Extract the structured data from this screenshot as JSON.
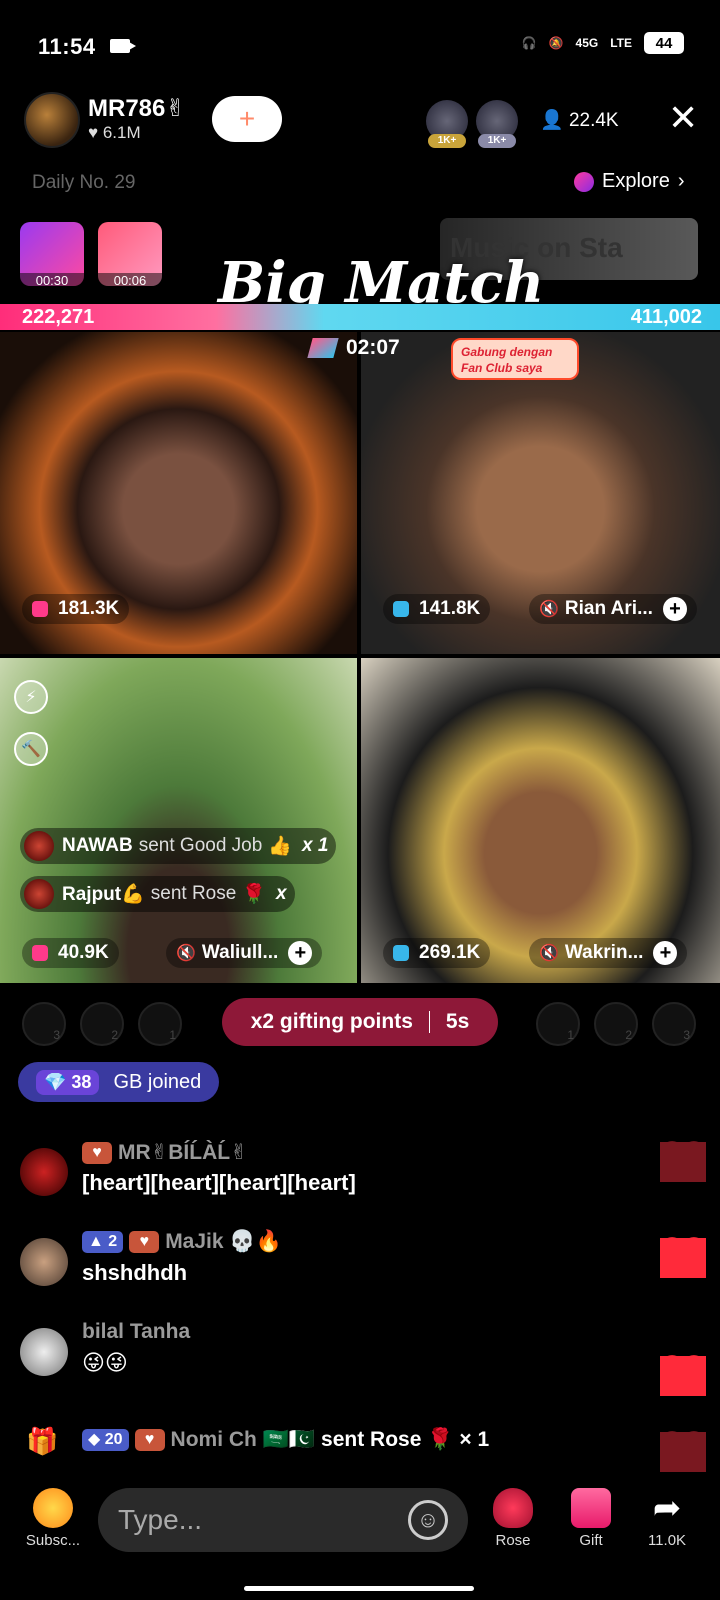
{
  "status_bar": {
    "time": "11:54",
    "network": "45G",
    "lte": "LTE",
    "battery": "44"
  },
  "header": {
    "host_name": "MR786✌",
    "host_likes": "♥ 6.1M",
    "follow_icon": "+",
    "top_viewer_badge_1": "1K+",
    "top_viewer_badge_2": "1K+",
    "viewer_count": "22.4K",
    "close_icon": "✕"
  },
  "subheader": {
    "daily_rank": "Daily No. 29",
    "explore_label": "Explore",
    "badge_1_timer": "00:30",
    "badge_2_timer": "00:06",
    "music_banner": "Music on Sta",
    "match_title": "Big Match"
  },
  "battle": {
    "score_left": "222,271",
    "score_right": "411,002",
    "timer": "02:07"
  },
  "videos": [
    {
      "score": "181.3K",
      "name": ""
    },
    {
      "score": "141.8K",
      "name": "Rian Ari...",
      "fanclub_text": "Gabung dengan Fan Club saya"
    },
    {
      "score": "40.9K",
      "name": "Waliull..."
    },
    {
      "score": "269.1K",
      "name": "Wakrin..."
    }
  ],
  "gift_notes": [
    {
      "name": "NAWAB",
      "action": "sent Good Job",
      "count": "x 1"
    },
    {
      "name": "Rajput💪",
      "action": "sent Rose",
      "count": "x"
    }
  ],
  "pk_bar": {
    "left_ranks": [
      "3",
      "2",
      "1"
    ],
    "right_ranks": [
      "1",
      "2",
      "3"
    ],
    "boost_label": "x2 gifting points",
    "boost_time": "5s"
  },
  "joined": {
    "level": "38",
    "text": "GB joined"
  },
  "chat": [
    {
      "user": "MR✌BÍĹÀĹ✌",
      "message": "[heart][heart][heart][heart]",
      "fan_level": ""
    },
    {
      "user": "MaJik 💀🔥",
      "message": "shshdhdh",
      "fan_level": "2"
    },
    {
      "user": "bilal Tanha",
      "message": "😜😜",
      "fan_level": ""
    }
  ],
  "gift_chat": {
    "fan_level": "20",
    "user": "Nomi Ch 🇸🇦🇵🇰",
    "action": "sent Rose 🌹",
    "count": "× 1"
  },
  "bottom_bar": {
    "subscribe_label": "Subsc...",
    "type_placeholder": "Type...",
    "rose_label": "Rose",
    "gift_label": "Gift",
    "share_count": "11.0K"
  },
  "colors": {
    "accent_pink": "#ff2d7a",
    "accent_blue": "#38c6ea",
    "boost_bg": "#8e1838",
    "heart_red": "#ff2a3a"
  }
}
